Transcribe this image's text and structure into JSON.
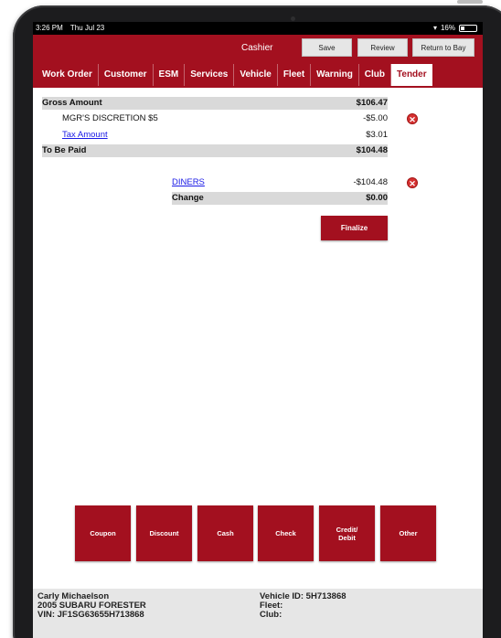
{
  "status_bar": {
    "time": "3:26 PM",
    "date": "Thu Jul 23",
    "battery": "16%"
  },
  "header": {
    "title": "Cashier",
    "buttons": {
      "save": "Save",
      "review": "Review",
      "return_to_bay": "Return to Bay"
    }
  },
  "tabs": [
    "Work Order",
    "Customer",
    "ESM",
    "Services",
    "Vehicle",
    "Fleet",
    "Warning",
    "Club",
    "Tender"
  ],
  "active_tab": "Tender",
  "summary": {
    "gross_amount_label": "Gross Amount",
    "gross_amount": "$106.47",
    "discount_label": "MGR'S DISCRETION $5",
    "discount_amount": "-$5.00",
    "tax_label": "Tax Amount",
    "tax_amount": "$3.01",
    "to_be_paid_label": "To Be Paid",
    "to_be_paid": "$104.48"
  },
  "payment": {
    "method": "DINERS",
    "amount": "-$104.48",
    "change_label": "Change",
    "change_amount": "$0.00"
  },
  "finalize_label": "Finalize",
  "payment_buttons": [
    "Coupon",
    "Discount",
    "Cash",
    "Check",
    "Credit/\nDebit",
    "Other"
  ],
  "footer": {
    "customer_name": "Carly Michaelson",
    "vehicle": "2005 SUBARU FORESTER",
    "vin": "VIN: JF1SG63655H713868",
    "vehicle_id": "Vehicle ID: 5H713868",
    "fleet": "Fleet:",
    "club": "Club:"
  },
  "colors": {
    "brand": "#a3101f",
    "shaded_row": "#d9d9d9",
    "link": "#1a1ae6",
    "remove": "#d63030"
  },
  "icons": {
    "remove": "close-circle-icon",
    "wifi": "wifi-icon",
    "battery": "battery-icon"
  }
}
